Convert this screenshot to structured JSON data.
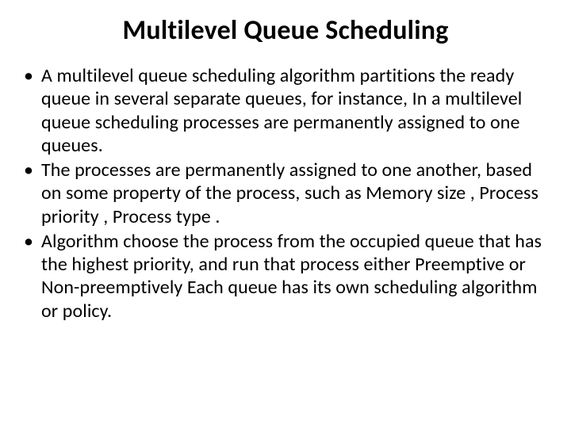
{
  "slide": {
    "title": "Multilevel Queue Scheduling",
    "bullets": [
      "A multilevel queue scheduling algorithm partitions the ready queue in several separate queues, for instance, In a multilevel queue scheduling processes are permanently assigned to one queues.",
      "The processes are permanently assigned to one another, based on some property of the process, such as Memory size , Process priority , Process type .",
      "Algorithm choose the process from the occupied queue that has the highest priority, and run that process either Preemptive or Non-preemptively Each queue has its own scheduling algorithm or policy."
    ]
  }
}
